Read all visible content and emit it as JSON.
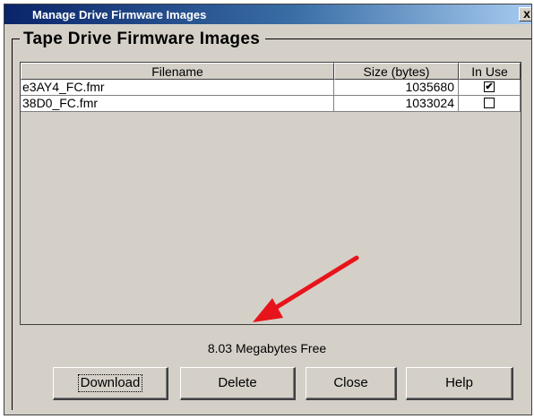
{
  "window": {
    "title": "Manage Drive Firmware Images",
    "close_label": "x"
  },
  "group": {
    "title": "Tape Drive Firmware Images"
  },
  "table": {
    "headers": [
      "Filename",
      "Size (bytes)",
      "In Use"
    ],
    "rows": [
      {
        "filename": "e3AY4_FC.fmr",
        "size": "1035680",
        "in_use": true,
        "mark": "✔"
      },
      {
        "filename": "38D0_FC.fmr",
        "size": "1033024",
        "in_use": false,
        "mark": ""
      }
    ]
  },
  "status": {
    "free_space": "8.03 Megabytes Free"
  },
  "buttons": {
    "download": "Download",
    "delete": "Delete",
    "close": "Close",
    "help": "Help"
  },
  "annotation": {
    "arrow_color": "#e8141b"
  }
}
